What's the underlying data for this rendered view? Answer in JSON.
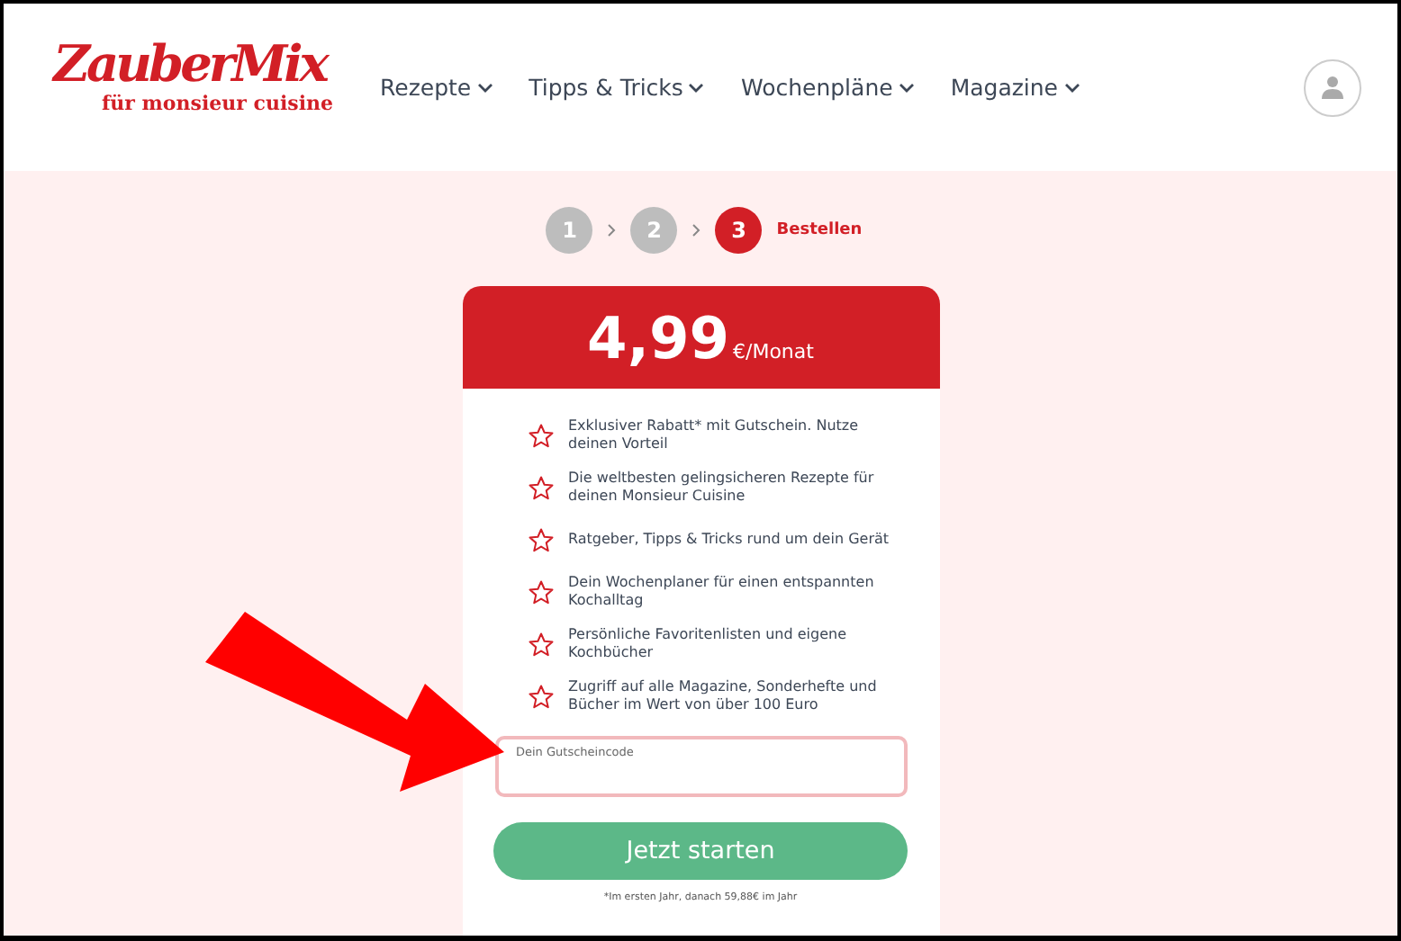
{
  "logo": {
    "name": "ZauberMix",
    "tagline": "für monsieur cuisine"
  },
  "nav": [
    {
      "label": "Rezepte"
    },
    {
      "label": "Tipps & Tricks"
    },
    {
      "label": "Wochenpläne"
    },
    {
      "label": "Magazine"
    }
  ],
  "steps": [
    {
      "number": "1",
      "selected": false
    },
    {
      "number": "2",
      "selected": false
    },
    {
      "number": "3",
      "selected": true,
      "label": "Bestellen"
    }
  ],
  "price": {
    "amount": "4,99",
    "unit": "€/Monat"
  },
  "features": [
    "Exklusiver Rabatt* mit Gutschein. Nutze deinen Vorteil",
    "Die weltbesten gelingsicheren Rezepte für deinen Monsieur Cuisine",
    "Ratgeber, Tipps & Tricks rund um dein Gerät",
    "Dein Wochenplaner für einen entspannten Kochalltag",
    "Persönliche Favoritenlisten und eigene Kochbücher",
    "Zugriff auf alle Magazine, Sonderhefte und Bücher im Wert von über 100 Euro"
  ],
  "voucher": {
    "placeholder": "Dein Gutscheincode"
  },
  "cta": "Jetzt starten",
  "footnote": "*Im ersten Jahr, danach 59,88€ im Jahr"
}
